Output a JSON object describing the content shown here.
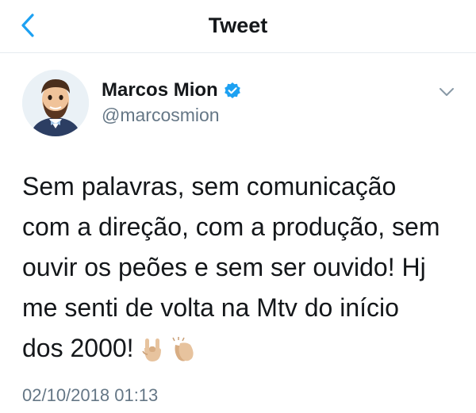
{
  "nav": {
    "title": "Tweet",
    "back_icon": "chevron-left-icon",
    "accent": "#1da1f2"
  },
  "author": {
    "name": "Marcos Mion",
    "handle": "@marcosmion",
    "verified": true,
    "verified_color": "#1da1f2"
  },
  "tweet": {
    "text": "Sem palavras, sem comunicação\ncom a direção, com a produção, sem\nouvir os peões e sem ser ouvido! Hj\nme senti de volta na Mtv do início\ndos 2000!",
    "emojis": [
      "sign-of-horns-icon",
      "clapping-hands-icon"
    ],
    "timestamp": "02/10/2018 01:13"
  }
}
